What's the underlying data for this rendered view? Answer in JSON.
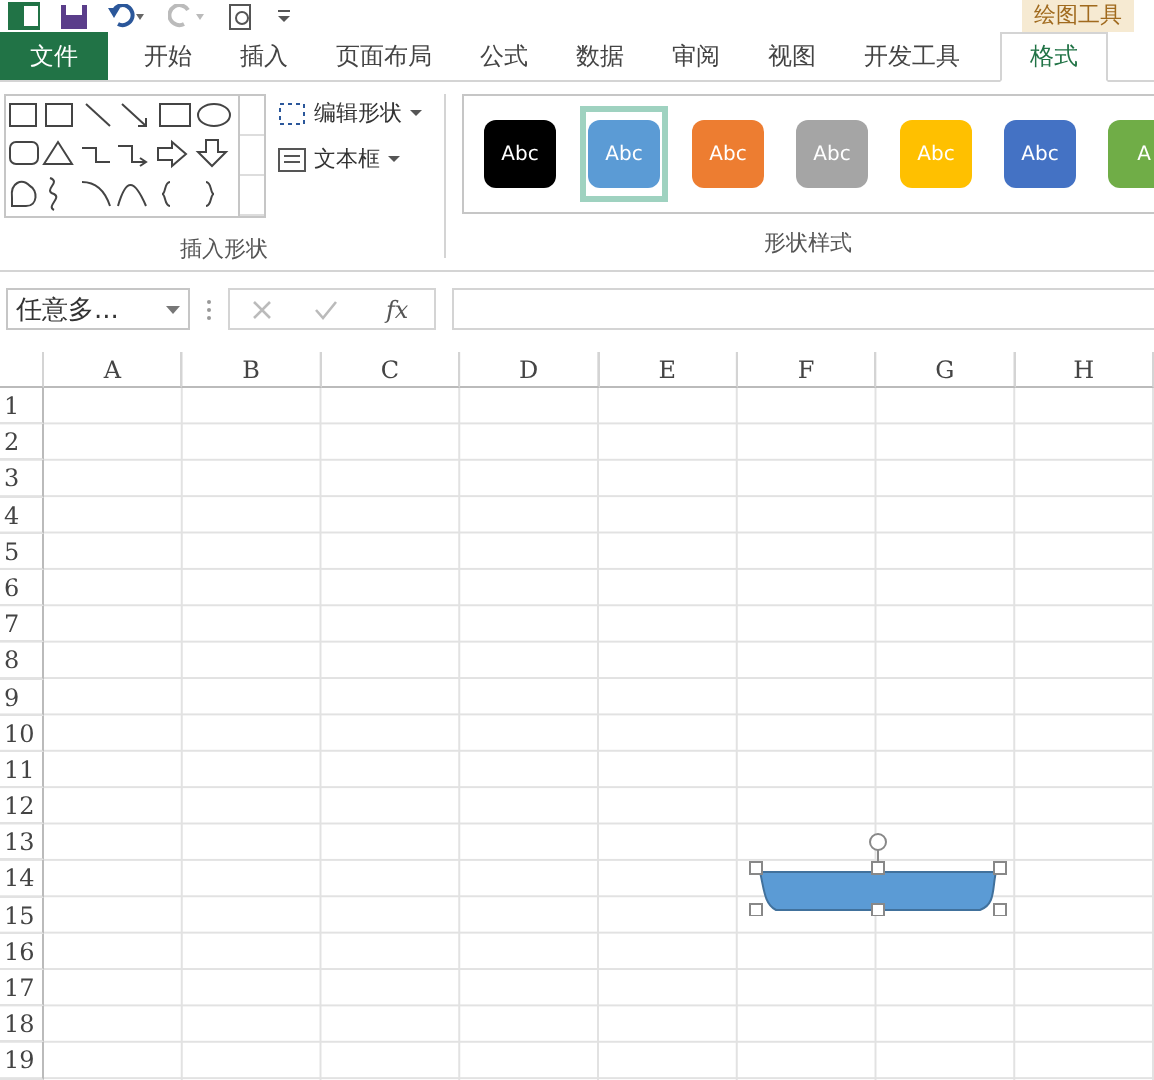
{
  "context_tab_group": "绘图工具",
  "tabs": [
    {
      "label": "文件",
      "kind": "file",
      "selected": false
    },
    {
      "label": "开始",
      "kind": "normal",
      "selected": false
    },
    {
      "label": "插入",
      "kind": "normal",
      "selected": false
    },
    {
      "label": "页面布局",
      "kind": "normal",
      "selected": false
    },
    {
      "label": "公式",
      "kind": "normal",
      "selected": false
    },
    {
      "label": "数据",
      "kind": "normal",
      "selected": false
    },
    {
      "label": "审阅",
      "kind": "normal",
      "selected": false
    },
    {
      "label": "视图",
      "kind": "normal",
      "selected": false
    },
    {
      "label": "开发工具",
      "kind": "normal",
      "selected": false
    },
    {
      "label": "格式",
      "kind": "normal",
      "selected": true
    }
  ],
  "insert_shapes": {
    "edit_shape": "编辑形状",
    "text_box": "文本框",
    "group_label": "插入形状"
  },
  "shape_styles": {
    "group_label": "形状样式",
    "styles": [
      {
        "label": "Abc",
        "color": "#000000",
        "selected": false
      },
      {
        "label": "Abc",
        "color": "#5b9bd5",
        "selected": true
      },
      {
        "label": "Abc",
        "color": "#ed7d31",
        "selected": false
      },
      {
        "label": "Abc",
        "color": "#a5a5a5",
        "selected": false
      },
      {
        "label": "Abc",
        "color": "#ffc000",
        "selected": false
      },
      {
        "label": "Abc",
        "color": "#4472c4",
        "selected": false
      },
      {
        "label": "A",
        "color": "#70ad47",
        "selected": false
      }
    ]
  },
  "name_box": {
    "value": "任意多..."
  },
  "formula_bar": {
    "function_button": "fx"
  },
  "sheet": {
    "columns": [
      "A",
      "B",
      "C",
      "D",
      "E",
      "F",
      "G",
      "H"
    ],
    "rows": [
      "1",
      "2",
      "3",
      "4",
      "5",
      "6",
      "7",
      "8",
      "9",
      "10",
      "11",
      "12",
      "13",
      "14",
      "15",
      "16",
      "17",
      "18",
      "19"
    ],
    "shape": {
      "selected": true
    }
  }
}
